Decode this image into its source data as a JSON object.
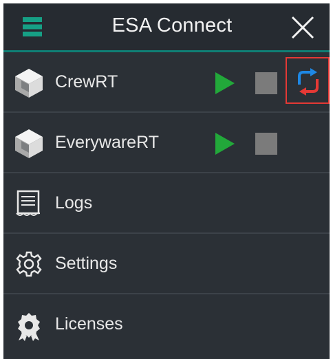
{
  "header": {
    "title": "ESA Connect",
    "menu_icon": "hamburger-menu-icon",
    "close_icon": "close-icon",
    "accent_color": "#16a085"
  },
  "services": [
    {
      "label": "CrewRT",
      "icon": "cube-logo-icon",
      "controls": [
        "play-icon",
        "stop-icon",
        "refresh-icon"
      ]
    },
    {
      "label": "EverywareRT",
      "icon": "cube-logo-icon",
      "controls": [
        "play-icon",
        "stop-icon"
      ]
    }
  ],
  "menu": [
    {
      "label": "Logs",
      "icon": "logs-icon"
    },
    {
      "label": "Settings",
      "icon": "gear-icon"
    },
    {
      "label": "Licenses",
      "icon": "award-badge-icon"
    }
  ],
  "colors": {
    "play": "#22a83a",
    "stop": "#7b7b7b",
    "refresh_up": "#1e88e5",
    "refresh_down": "#e53935",
    "highlight": "#e53935"
  }
}
